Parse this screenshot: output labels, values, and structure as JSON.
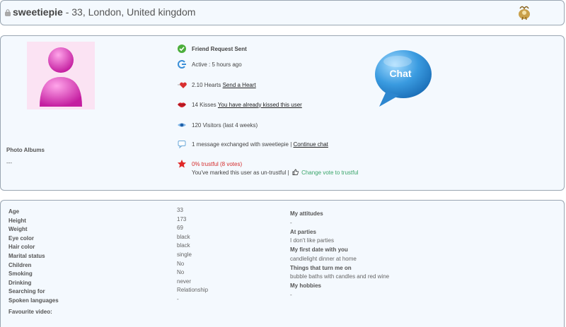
{
  "header": {
    "username": "sweetiepie",
    "details": " - 33, London, United kingdom"
  },
  "profile": {
    "photo_albums_label": "Photo Albums",
    "photo_albums_value": "---",
    "friend_request": "Friend Request Sent",
    "active": "Active : 5 hours ago",
    "hearts_text": "2.10 Hearts",
    "hearts_link": "Send a Heart",
    "kisses_text": "14 Kisses",
    "kisses_link": "You have already kissed this user",
    "visitors": "120 Visitors (last 4 weeks)",
    "messages_text": "1 message exchanged with sweetiepie |",
    "messages_link": "Continue chat",
    "trust": "0% trustful (8 votes)",
    "untrust_note": "You've marked this user as un-trustful |",
    "change_vote": "Change vote to trustful",
    "chat_label": "Chat"
  },
  "details": {
    "fields": [
      {
        "label": "Age",
        "value": "33"
      },
      {
        "label": "Height",
        "value": "173"
      },
      {
        "label": "Weight",
        "value": "69"
      },
      {
        "label": "Eye color",
        "value": "black"
      },
      {
        "label": "Hair color",
        "value": "black"
      },
      {
        "label": "Marital status",
        "value": "single"
      },
      {
        "label": "Children",
        "value": "No"
      },
      {
        "label": "Smoking",
        "value": "No"
      },
      {
        "label": "Drinking",
        "value": "never"
      },
      {
        "label": "Searching for",
        "value": "Relationship"
      },
      {
        "label": "Spoken languages",
        "value": "-"
      }
    ],
    "favourite_video_label": "Favourite video:",
    "right": [
      {
        "heading": "My attitudes",
        "value": "-"
      },
      {
        "heading": "At parties",
        "value": "I don't like parties"
      },
      {
        "heading": "My first date with you",
        "value": "candlelight dinner at home"
      },
      {
        "heading": "Things that turn me on",
        "value": "bubble baths with candles and red wine"
      },
      {
        "heading": "My hobbies",
        "value": "-"
      }
    ]
  },
  "colors": {
    "panel_bg": "#f4f9fe",
    "border": "#9aa6b2",
    "avatar_pink": "#e64fc4",
    "chat_blue": "#3a9be0",
    "trust_red": "#d42b2b",
    "link_green": "#3aa56a"
  },
  "icons": [
    "lock-icon",
    "capricorn-zodiac-icon",
    "checkmark-icon",
    "active-arrow-icon",
    "heart-icon",
    "kiss-lips-icon",
    "eye-icon",
    "speech-bubble-icon",
    "star-icon",
    "thumbs-up-icon",
    "chat-bubble-icon",
    "avatar-placeholder-icon"
  ]
}
